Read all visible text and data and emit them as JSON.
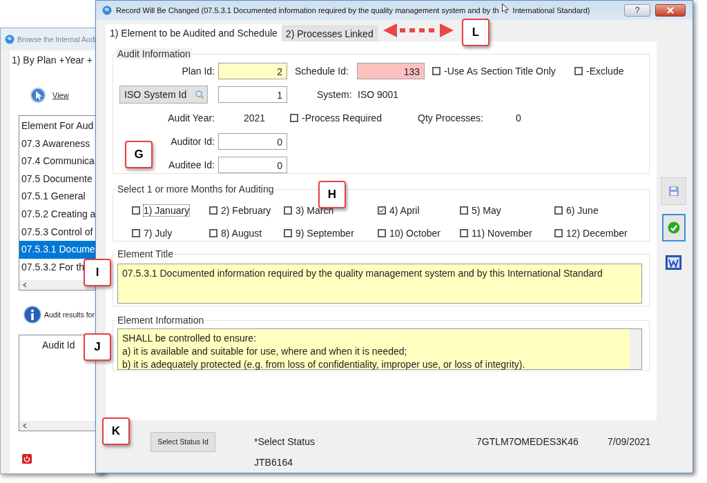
{
  "background_window": {
    "title": "Browse the Internal Audi",
    "tab": "1) By Plan +Year +",
    "view_link": "View",
    "list": {
      "header": "Element For Aud",
      "items": [
        {
          "label": "07.3 Awareness",
          "selected": false
        },
        {
          "label": "07.4 Communica",
          "selected": false
        },
        {
          "label": "07.5 Documente",
          "selected": false
        },
        {
          "label": "07.5.1 General",
          "selected": false
        },
        {
          "label": "07.5.2 Creating a",
          "selected": false
        },
        {
          "label": "07.5.3 Control of",
          "selected": false
        },
        {
          "label": "07.5.3.1 Docume",
          "selected": true
        },
        {
          "label": "07.5.3.2 For th",
          "selected": false
        }
      ]
    },
    "audit_results_label": "Audit results for",
    "grid": {
      "columns": [
        "Audit Id"
      ]
    }
  },
  "window": {
    "title": "Record Will Be Changed  (07.5.3.1 Documented information required by the quality management system and by th",
    "title_continued": "International Standard)",
    "help_button": "?"
  },
  "tabs": [
    {
      "label": "1) Element to be Audited and Schedule",
      "selected": true
    },
    {
      "label": "2) Processes Linked",
      "selected": false
    }
  ],
  "audit_information": {
    "title": "Audit Information",
    "plan_id": {
      "label": "Plan Id:",
      "value": "2"
    },
    "schedule_id": {
      "label": "Schedule Id:",
      "value": "133"
    },
    "use_as_section_title_only": {
      "label": "-Use As Section Title Only",
      "checked": false
    },
    "exclude": {
      "label": "-Exclude",
      "checked": false
    },
    "iso_system_button": "ISO System Id",
    "iso_system_id": "1",
    "system": {
      "label": "System:",
      "value": "ISO 9001"
    },
    "audit_year": {
      "label": "Audit Year:",
      "value": "2021"
    },
    "process_required": {
      "label": "-Process Required",
      "checked": false
    },
    "qty_processes": {
      "label": "Qty Processes:",
      "value": "0"
    },
    "auditor_id": {
      "label": "Auditor Id:",
      "value": "0"
    },
    "auditee_id": {
      "label": "Auditee Id:",
      "value": "0"
    }
  },
  "months": {
    "title": "Select 1 or more Months for Auditing",
    "items": [
      {
        "label": "1) January",
        "checked": false
      },
      {
        "label": "2) February",
        "checked": false
      },
      {
        "label": "3) March",
        "checked": false
      },
      {
        "label": "4) April",
        "checked": true
      },
      {
        "label": "5) May",
        "checked": false
      },
      {
        "label": "6) June",
        "checked": false
      },
      {
        "label": "7) July",
        "checked": false
      },
      {
        "label": "8) August",
        "checked": false
      },
      {
        "label": "9) September",
        "checked": false
      },
      {
        "label": "10) October",
        "checked": false
      },
      {
        "label": "11) November",
        "checked": false
      },
      {
        "label": "12) December",
        "checked": false
      }
    ]
  },
  "element_title": {
    "title": "Element Title",
    "text": "07.5.3.1 Documented information required by the quality management system and by this International Standard"
  },
  "element_information": {
    "title": "Element Information",
    "text": "SHALL be controlled to ensure:\na) it is available and suitable for use, where and when it is needed;\nb) it is adequately protected (e.g. from loss of confidentiality, improper use, or loss of integrity)."
  },
  "footer": {
    "status_button": "Select Status Id",
    "status_label": "*Select Status",
    "user": "JTB6164",
    "code": "7GTLM7OMEDES3K46",
    "date": "7/09/2021"
  },
  "annotations": [
    {
      "label": "G"
    },
    {
      "label": "H"
    },
    {
      "label": "I"
    },
    {
      "label": "J"
    },
    {
      "label": "K"
    },
    {
      "label": "L"
    }
  ]
}
